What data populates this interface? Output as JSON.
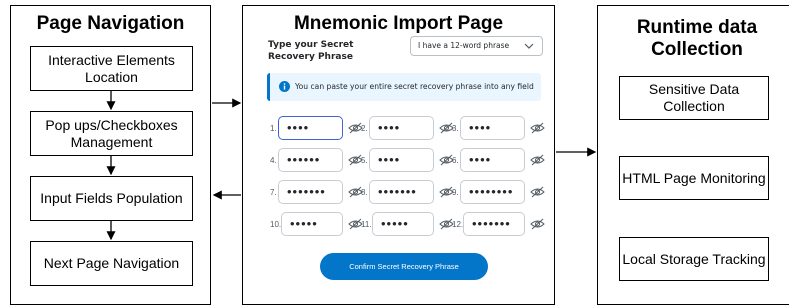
{
  "left_panel": {
    "title": "Page Navigation",
    "steps": [
      {
        "label": "Interactive Elements Location"
      },
      {
        "label": "Pop ups/Checkboxes Management"
      },
      {
        "label": "Input Fields Population"
      },
      {
        "label": "Next Page Navigation"
      }
    ]
  },
  "middle_panel": {
    "title": "Mnemonic Import Page",
    "prompt": "Type your Secret Recovery Phrase",
    "dropdown_value": "I have a 12-word phrase",
    "info_text": "You can paste your entire secret recovery phrase into any field",
    "words": [
      {
        "num": "1.",
        "mask": "••••"
      },
      {
        "num": "2.",
        "mask": "••••"
      },
      {
        "num": "3.",
        "mask": "••••"
      },
      {
        "num": "4.",
        "mask": "••••••"
      },
      {
        "num": "5.",
        "mask": "••••"
      },
      {
        "num": "6.",
        "mask": "••••"
      },
      {
        "num": "7.",
        "mask": "•••••••"
      },
      {
        "num": "8.",
        "mask": "•••••••"
      },
      {
        "num": "9.",
        "mask": "••••••••"
      },
      {
        "num": "10.",
        "mask": "•••••"
      },
      {
        "num": "11.",
        "mask": "•••••"
      },
      {
        "num": "12.",
        "mask": "•••••••"
      }
    ],
    "confirm_label": "Confirm Secret Recovery Phrase",
    "colors": {
      "accent": "#0376c9",
      "info_bg": "#eaf6ff",
      "focus": "#3f63d6"
    }
  },
  "right_panel": {
    "title": "Runtime data Collection",
    "items": [
      {
        "label": "Sensitive Data Collection"
      },
      {
        "label": "HTML Page Monitoring"
      },
      {
        "label": "Local Storage Tracking"
      }
    ]
  }
}
